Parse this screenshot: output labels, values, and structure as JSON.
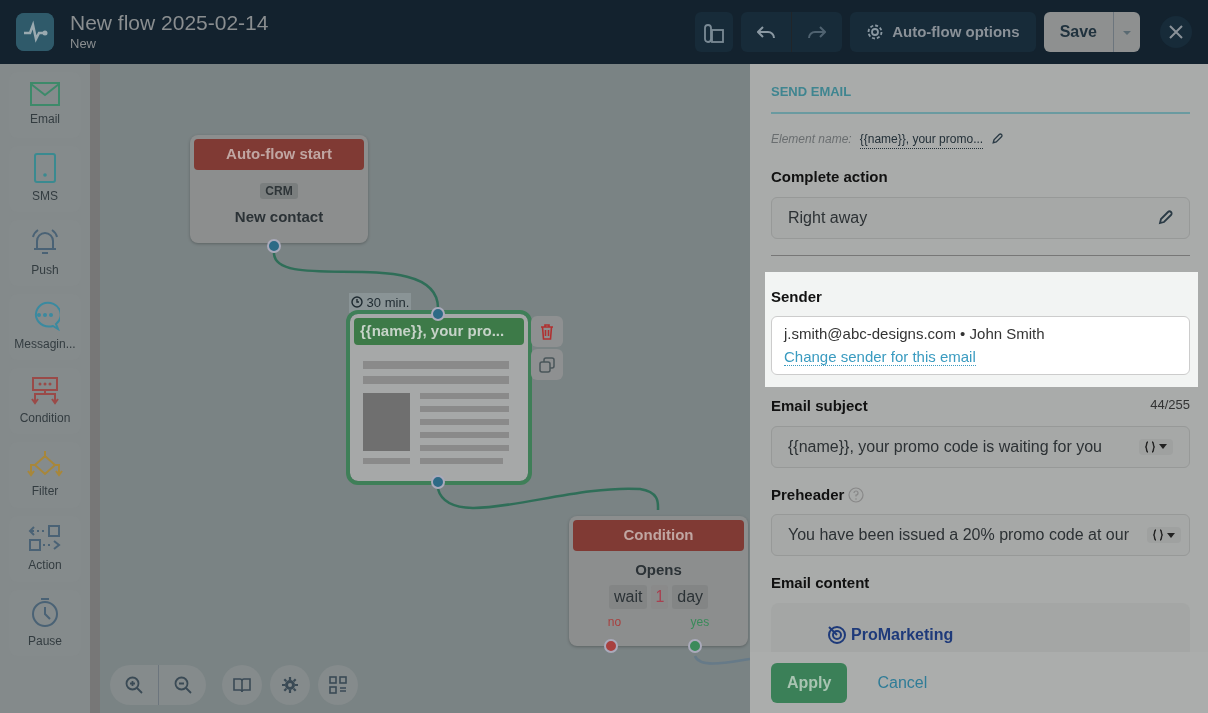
{
  "header": {
    "title": "New flow 2025-02-14",
    "subtitle": "New",
    "options_label": "Auto-flow options",
    "save_label": "Save"
  },
  "palette": [
    {
      "kind": "email",
      "label": "Email"
    },
    {
      "kind": "sms",
      "label": "SMS"
    },
    {
      "kind": "push",
      "label": "Push"
    },
    {
      "kind": "messaging",
      "label": "Messagin..."
    },
    {
      "kind": "condition",
      "label": "Condition"
    },
    {
      "kind": "filter",
      "label": "Filter"
    },
    {
      "kind": "action",
      "label": "Action"
    },
    {
      "kind": "pause",
      "label": "Pause"
    }
  ],
  "nodes": [
    {
      "kind": "start",
      "selected": false,
      "header": "Auto-flow start",
      "badge": "CRM",
      "title": "New contact"
    },
    {
      "kind": "email",
      "selected": true,
      "delay": "30 min.",
      "title": "{{name}}, your pro..."
    },
    {
      "kind": "condition",
      "selected": false,
      "header": "Condition",
      "title": "Opens",
      "wait": [
        "wait",
        "1",
        "day"
      ],
      "outputs": [
        {
          "label": "no",
          "color": "#a8403f"
        },
        {
          "label": "yes",
          "color": "#3a8a5a"
        }
      ]
    }
  ],
  "panel": {
    "section_title": "SEND EMAIL",
    "element_name_label": "Element name:",
    "element_name": "{{name}}, your promo...",
    "complete_action_label": "Complete action",
    "complete_action_value": "Right away",
    "sender_label": "Sender",
    "sender_value": "j.smith@abc-designs.com • John Smith",
    "sender_link": "Change sender for this email",
    "subject_label": "Email subject",
    "subject_counter": "44/255",
    "subject_value": "{{name}}, your promo code is waiting for you",
    "preheader_label": "Preheader",
    "preheader_value": "You have been issued a 20% promo code at our",
    "content_label": "Email content",
    "content_logo": "ProMarketing",
    "apply_label": "Apply",
    "cancel_label": "Cancel"
  }
}
